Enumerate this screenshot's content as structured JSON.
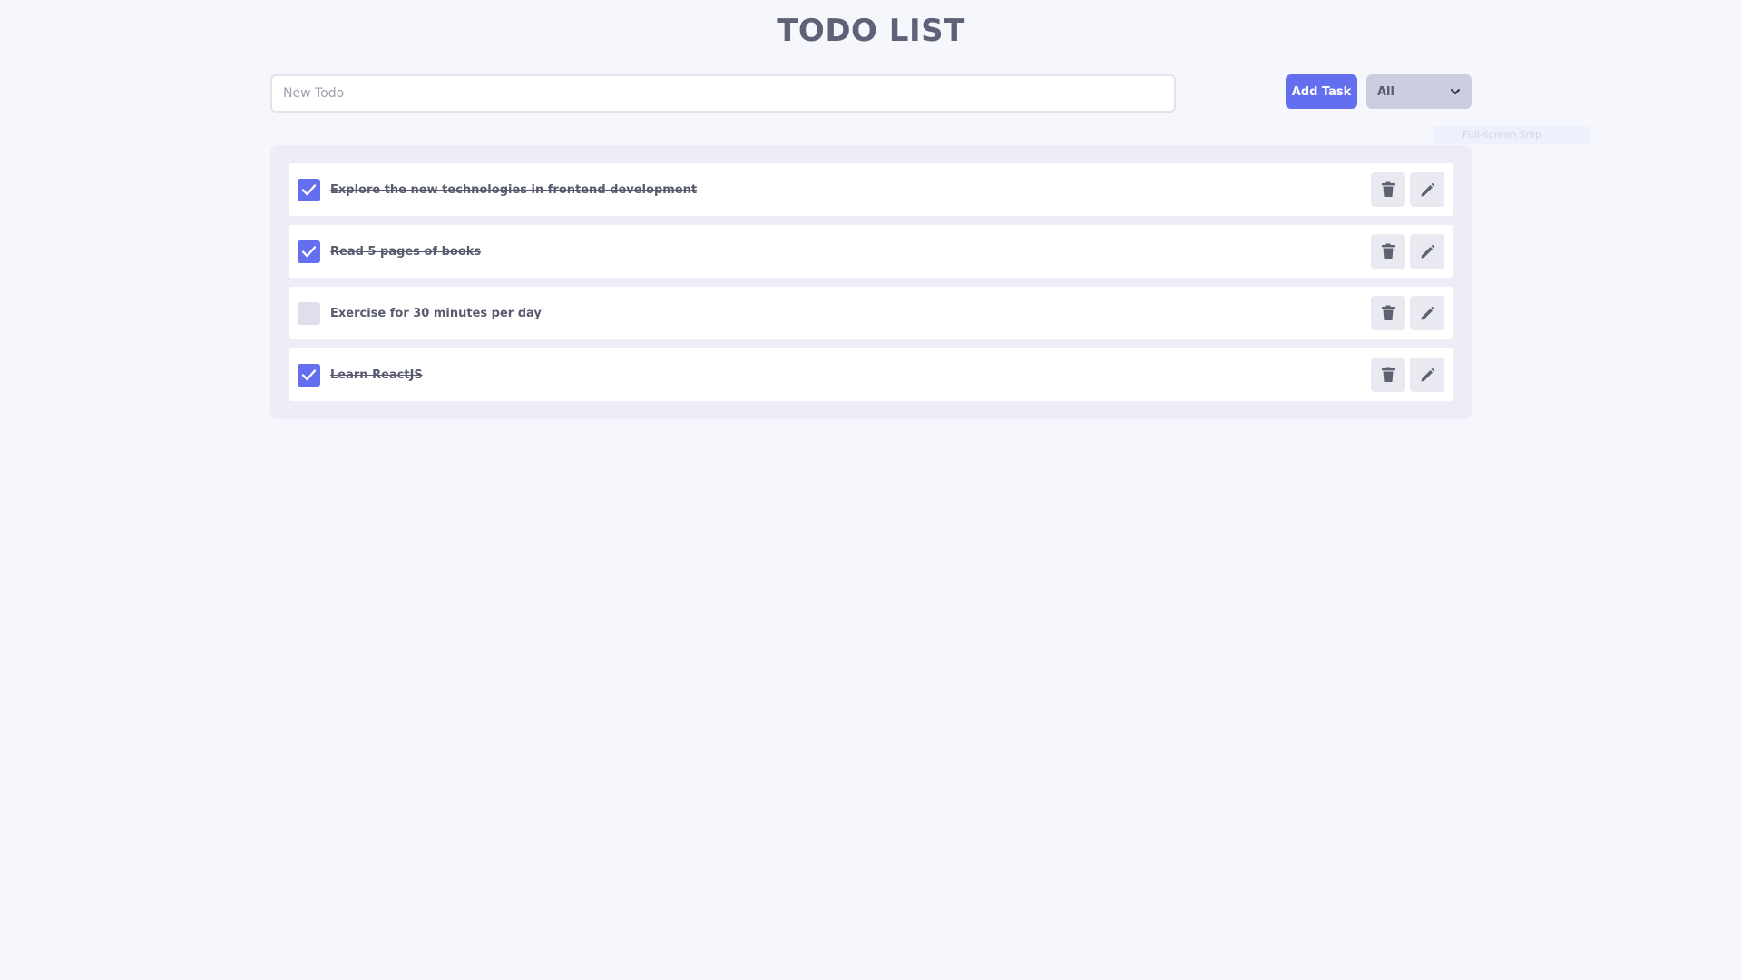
{
  "header": {
    "title": "TODO LIST"
  },
  "form": {
    "input_placeholder": "New Todo",
    "input_value": "",
    "add_label": "Add Task",
    "filter_selected": "All"
  },
  "overlay": {
    "snip_label": "Full-screen Snip"
  },
  "todos": [
    {
      "text": "Explore the new technologies in frontend development",
      "completed": true
    },
    {
      "text": "Read 5 pages of books",
      "completed": true
    },
    {
      "text": "Exercise for 30 minutes per day",
      "completed": false
    },
    {
      "text": "Learn ReactJS",
      "completed": true
    }
  ],
  "icons": {
    "delete": "trash-icon",
    "edit": "pencil-icon",
    "check": "checkmark-icon",
    "dropdown": "chevron-down-icon"
  },
  "colors": {
    "accent": "#646ff0",
    "background": "#f6f7fd",
    "panel": "#ecedf6",
    "text": "#585b6e"
  }
}
